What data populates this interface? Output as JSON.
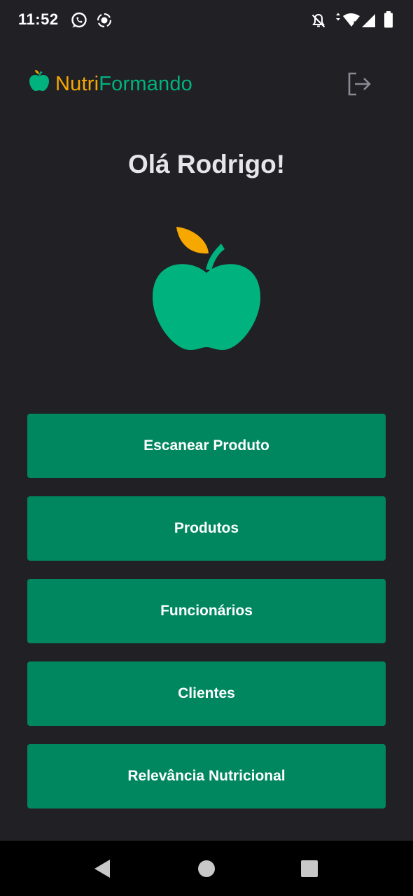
{
  "status_bar": {
    "time": "11:52",
    "left_icons": [
      "whatsapp-icon",
      "screen-record-icon"
    ],
    "right_icons": [
      "notifications-off-icon",
      "wifi-icon",
      "signal-icon",
      "battery-icon"
    ]
  },
  "header": {
    "brand_part1": "Nutri",
    "brand_part2": "Formando",
    "logo_icon": "apple-logo-icon",
    "logout_icon": "logout-icon"
  },
  "greeting": "Olá Rodrigo!",
  "hero_icon": "apple-illustration",
  "menu": {
    "scan_label": "Escanear Produto",
    "products_label": "Produtos",
    "employees_label": "Funcionários",
    "clients_label": "Clientes",
    "nutrition_label": "Relevância Nutricional"
  },
  "nav_bar": {
    "back_icon": "back-triangle-icon",
    "home_icon": "home-circle-icon",
    "recents_icon": "recents-square-icon"
  },
  "colors": {
    "background": "#212025",
    "accent_green": "#00875f",
    "brand_green": "#00b37e",
    "brand_orange": "#f6a800"
  }
}
